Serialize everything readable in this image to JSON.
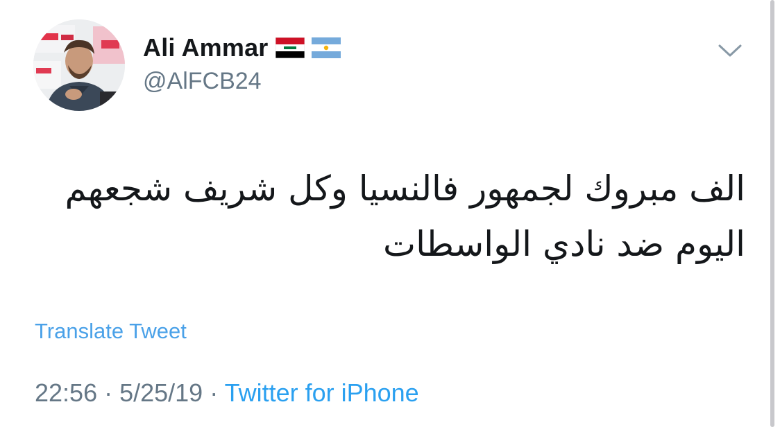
{
  "user": {
    "display_name": "Ali Ammar",
    "handle": "@AlFCB24",
    "flags": [
      "iraq-flag",
      "argentina-flag"
    ]
  },
  "tweet": {
    "text_line1": "الف مبروك لجمهور فالنسيا وكل شريف شجعهم",
    "text_line2": "اليوم ضد نادي الواسطات",
    "translate_label": "Translate Tweet",
    "time": "22:56",
    "separator1": " · ",
    "date": "5/25/19",
    "separator2": " · ",
    "source": "Twitter for iPhone"
  },
  "icons": {
    "menu": "chevron-down-icon"
  },
  "colors": {
    "text": "#14171a",
    "secondary": "#657786",
    "link": "#2aa0f0"
  }
}
